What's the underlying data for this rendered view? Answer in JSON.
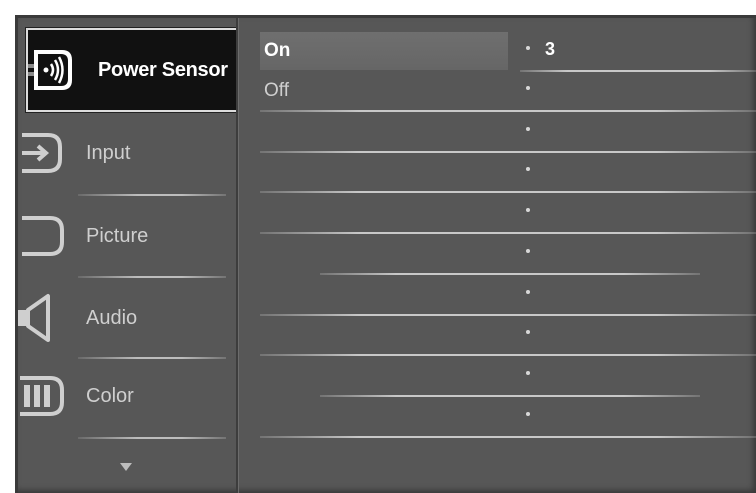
{
  "sidebar": {
    "items": [
      {
        "label": "Power Sensor",
        "icon": "power-sensor-icon",
        "active": true
      },
      {
        "label": "Input",
        "icon": "input-icon",
        "active": false
      },
      {
        "label": "Picture",
        "icon": "picture-icon",
        "active": false
      },
      {
        "label": "Audio",
        "icon": "audio-icon",
        "active": false
      },
      {
        "label": "Color",
        "icon": "color-icon",
        "active": false
      }
    ],
    "more_icon": "chevron-down-icon"
  },
  "options": {
    "items": [
      {
        "label": "On",
        "selected": true,
        "value": "3"
      },
      {
        "label": "Off",
        "selected": false,
        "value": ""
      },
      {
        "label": "",
        "selected": false,
        "value": ""
      },
      {
        "label": "",
        "selected": false,
        "value": ""
      },
      {
        "label": "",
        "selected": false,
        "value": ""
      },
      {
        "label": "",
        "selected": false,
        "value": ""
      },
      {
        "label": "",
        "selected": false,
        "value": ""
      },
      {
        "label": "",
        "selected": false,
        "value": ""
      },
      {
        "label": "",
        "selected": false,
        "value": ""
      },
      {
        "label": "",
        "selected": false,
        "value": ""
      }
    ]
  },
  "colors": {
    "panel_bg": "#575757",
    "active_bg": "#111111",
    "text": "#cfcfcf",
    "highlight": "#ffffff"
  }
}
